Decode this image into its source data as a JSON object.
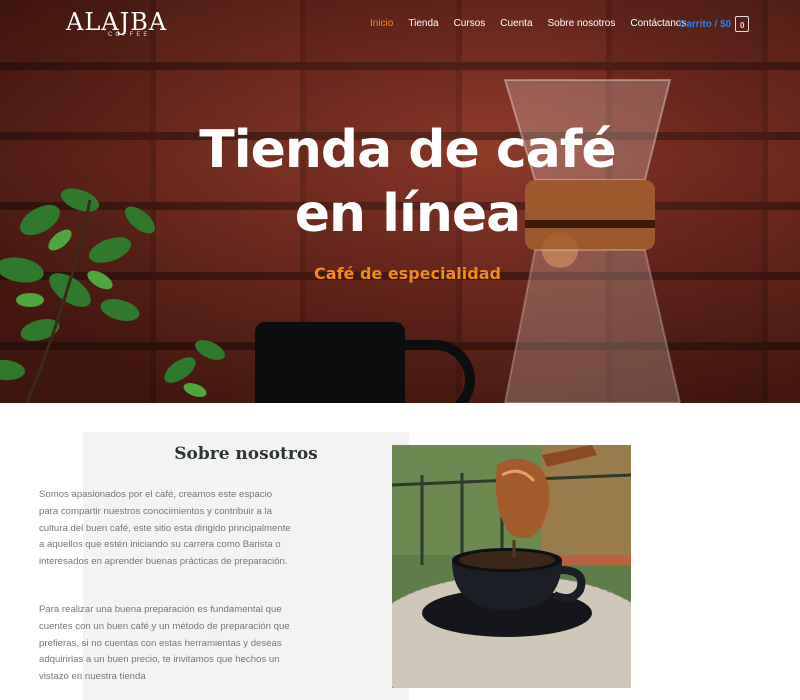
{
  "brand": {
    "logo_text": "ALAJBA",
    "logo_subtext": "COFFEE"
  },
  "nav": {
    "items": [
      {
        "label": "Inicio",
        "active": true
      },
      {
        "label": "Tienda",
        "active": false
      },
      {
        "label": "Cursos",
        "active": false
      },
      {
        "label": "Cuenta",
        "active": false
      },
      {
        "label": "Sobre nosotros",
        "active": false
      },
      {
        "label": "Contáctanos",
        "active": false
      }
    ],
    "cart_label": "Carrito / $0",
    "cart_count": "0"
  },
  "hero": {
    "title_line1": "Tienda de café",
    "title_line2": "en línea",
    "subtitle": "Café de especialidad"
  },
  "about": {
    "title": "Sobre nosotros",
    "paragraph1": "Somos apasionados por el café, creamos este espacio para compartir nuestros conocimientos y contribuir a la cultura del buen café, este sitio esta dirigido principalmente a aquellos que estén iniciando su carrera como Barista o interesados en aprender buenas prácticas de preparación.",
    "paragraph2": "Para realizar una buena preparación es fundamental que cuentes con un buen café y un método de preparación que prefieras, si no cuentas con estas herramientas y deseas adquirirlas a un buen precio, te invitamos que hechos un vistazo en nuestra tienda"
  },
  "colors": {
    "accent": "#f28a1a",
    "cart": "#2f7de1",
    "heading": "#2d3436",
    "body_text": "#777777",
    "card_bg": "#f3f3f3"
  }
}
